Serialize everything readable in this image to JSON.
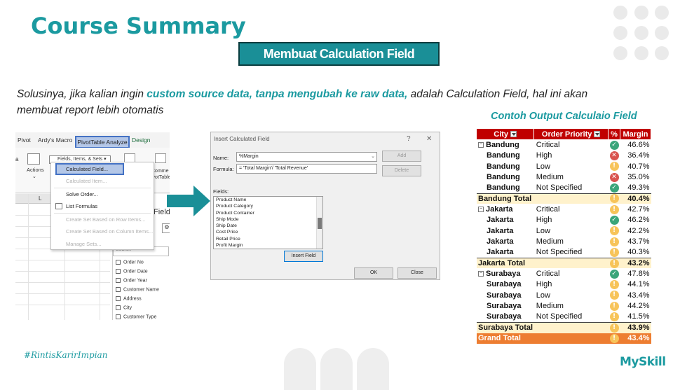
{
  "slide": {
    "title": "Course Summary",
    "banner": "Membuat Calculation Field",
    "desc_pre": "Solusinya,  jika kalian ingin ",
    "desc_hl": "custom source data, tanpa mengubah ke raw data,",
    "desc_post": " adalah Calculation Field, hal ini akan membuat report lebih otomatis",
    "example_title": "Contoh Output Calculaio Field",
    "hashtag": "#RintisKarirImpian",
    "logo": "MySkill"
  },
  "excel": {
    "tabs": [
      "Pivot",
      "Ardy's Macro",
      "PivotTable Analyze",
      "Design"
    ],
    "fields_items_btn": "Fields, Items, & Sets",
    "actions_label": "Actions",
    "comment_label": "Comme",
    "pivot_label": "ivotTable",
    "col_letter": "L",
    "pane_title": "Field",
    "search_placeholder": "Search",
    "menu": [
      {
        "label": "Calculated Field...",
        "state": "selected"
      },
      {
        "label": "Calculated Item...",
        "state": "disabled"
      },
      {
        "label": "Solve Order...",
        "state": "normal"
      },
      {
        "label": "List Formulas",
        "state": "normal"
      },
      {
        "label": "Create Set Based on Row Items...",
        "state": "disabled"
      },
      {
        "label": "Create Set Based on Column Items...",
        "state": "disabled"
      },
      {
        "label": "Manage Sets...",
        "state": "disabled"
      }
    ],
    "pane_fields": [
      "Order No",
      "Order Date",
      "Order Year",
      "Customer Name",
      "Address",
      "City",
      "Customer Type"
    ]
  },
  "dialog": {
    "title": "Insert Calculated Field",
    "help": "?",
    "close_x": "✕",
    "name_label": "Name:",
    "name_value": "%Margin",
    "formula_label": "Formula:",
    "formula_value": "= 'Total Margin'/ 'Total Revenue'",
    "add_btn": "Add",
    "delete_btn": "Delete",
    "fields_label": "Fields:",
    "fields": [
      "Product Name",
      "Product Category",
      "Product Container",
      "Ship Mode",
      "Ship Date",
      "Cost Price",
      "Retail Price",
      "Profit Margin"
    ],
    "insert_btn": "Insert Field",
    "ok_btn": "OK",
    "close_btn": "Close"
  },
  "pivot": {
    "headers": [
      "City",
      "Order Priority",
      "%",
      "Margin"
    ],
    "groups": [
      {
        "city": "Bandung",
        "rows": [
          {
            "priority": "Critical",
            "status": "good",
            "value": "46.6%"
          },
          {
            "priority": "High",
            "status": "bad",
            "value": "36.4%"
          },
          {
            "priority": "Low",
            "status": "warn",
            "value": "40.7%"
          },
          {
            "priority": "Medium",
            "status": "bad",
            "value": "35.0%"
          },
          {
            "priority": "Not Specified",
            "status": "good",
            "value": "49.3%"
          }
        ],
        "total_label": "Bandung Total",
        "total_value": "40.4%"
      },
      {
        "city": "Jakarta",
        "rows": [
          {
            "priority": "Critical",
            "status": "warn",
            "value": "42.7%"
          },
          {
            "priority": "High",
            "status": "good",
            "value": "46.2%"
          },
          {
            "priority": "Low",
            "status": "warn",
            "value": "42.2%"
          },
          {
            "priority": "Medium",
            "status": "warn",
            "value": "43.7%"
          },
          {
            "priority": "Not Specified",
            "status": "warn",
            "value": "40.3%"
          }
        ],
        "total_label": "Jakarta Total",
        "total_value": "43.2%"
      },
      {
        "city": "Surabaya",
        "rows": [
          {
            "priority": "Critical",
            "status": "good",
            "value": "47.8%"
          },
          {
            "priority": "High",
            "status": "warn",
            "value": "44.1%"
          },
          {
            "priority": "Low",
            "status": "warn",
            "value": "43.4%"
          },
          {
            "priority": "Medium",
            "status": "warn",
            "value": "44.2%"
          },
          {
            "priority": "Not Specified",
            "status": "warn",
            "value": "41.5%"
          }
        ],
        "total_label": "Surabaya Total",
        "total_value": "43.9%"
      }
    ],
    "grand_label": "Grand Total",
    "grand_status": "warn",
    "grand_value": "43.4%",
    "total_statuses": [
      "warn",
      "warn",
      "warn"
    ],
    "colors": {
      "header": "#c00000",
      "total": "#fff2cc",
      "grand": "#ed7d31",
      "good": "#3aa57a",
      "bad": "#d9534f",
      "warn": "#f7c45a"
    }
  }
}
